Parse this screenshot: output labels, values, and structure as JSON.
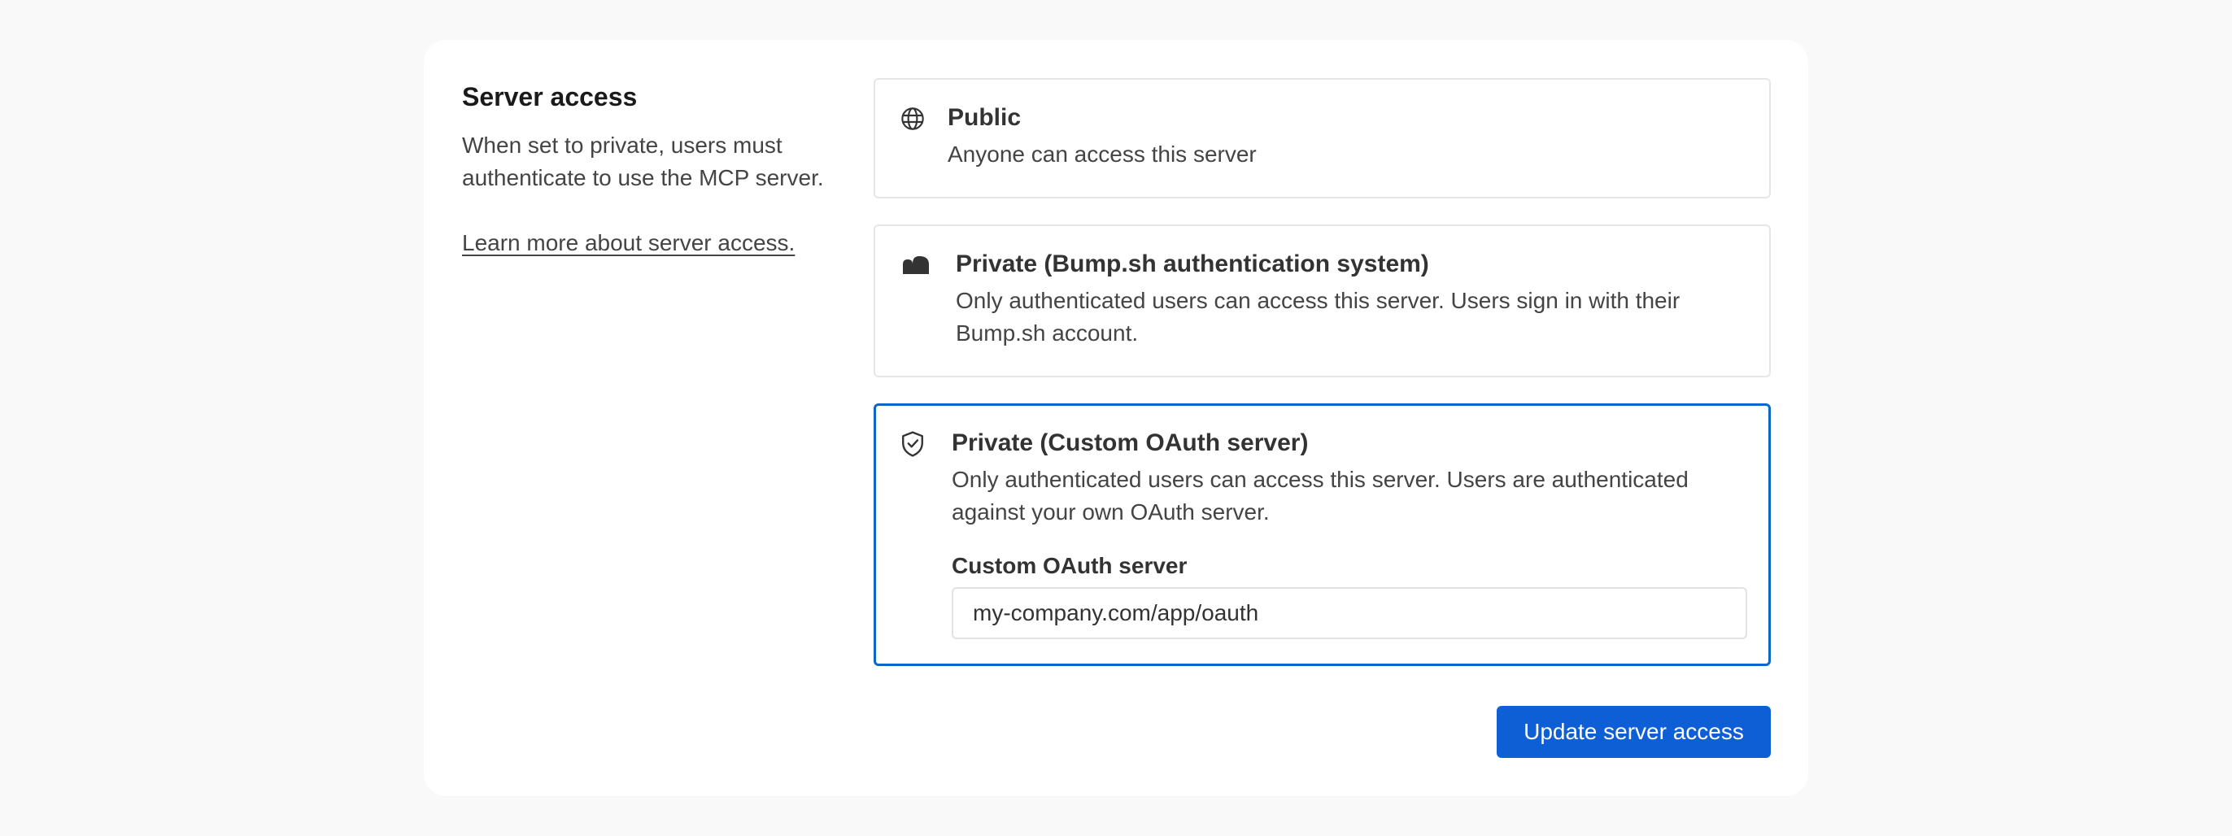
{
  "section": {
    "title": "Server access",
    "description": "When set to private, users must authenticate to use the MCP server.",
    "learn_more": "Learn more about server access."
  },
  "options": {
    "public": {
      "icon": "globe-icon",
      "title": "Public",
      "description": "Anyone can access this server",
      "selected": false
    },
    "bump": {
      "icon": "bump-logo-icon",
      "title": "Private (Bump.sh authentication system)",
      "description": "Only authenticated users can access this server. Users sign in with their Bump.sh account.",
      "selected": false
    },
    "custom": {
      "icon": "shield-check-icon",
      "title": "Private (Custom OAuth server)",
      "description": "Only authenticated users can access this server. Users are authenticated against your own OAuth server.",
      "selected": true,
      "field_label": "Custom OAuth server",
      "field_value": "my-company.com/app/oauth"
    }
  },
  "actions": {
    "update_label": "Update server access"
  },
  "colors": {
    "accent": "#0e5fd6",
    "selected_border": "#0e66c8"
  }
}
